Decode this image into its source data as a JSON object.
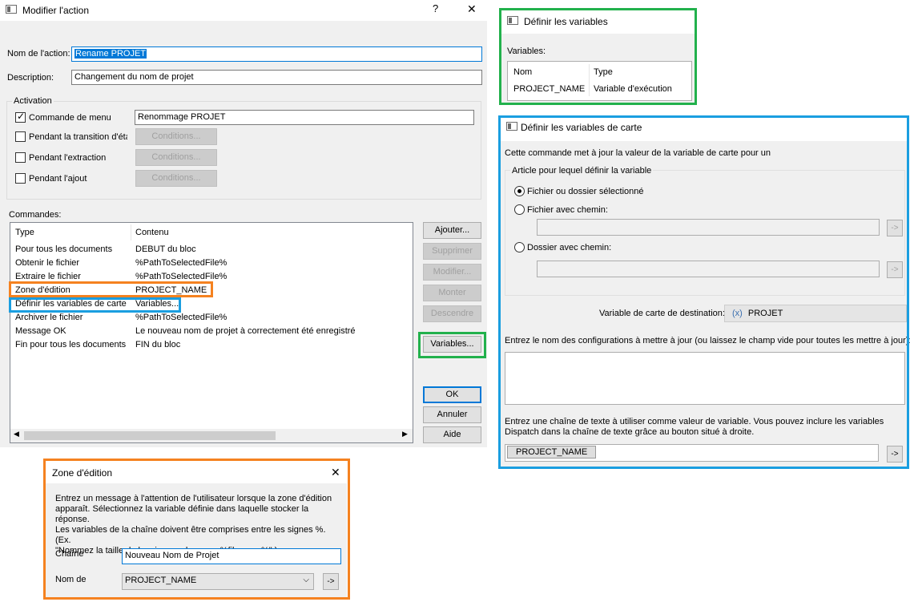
{
  "modifier": {
    "title": "Modifier l'action",
    "help": "?",
    "close": "✕",
    "nom_label": "Nom de l'action:",
    "nom_value": "Rename PROJET",
    "desc_label": "Description:",
    "desc_value": "Changement du nom de projet",
    "activation_label": "Activation",
    "activations": [
      {
        "label": "Commande de menu",
        "value": "Renommage PROJET"
      },
      {
        "label": "Pendant la transition d'état",
        "button": "Conditions..."
      },
      {
        "label": "Pendant l'extraction",
        "button": "Conditions..."
      },
      {
        "label": "Pendant l'ajout",
        "button": "Conditions..."
      }
    ],
    "commandes_label": "Commandes:",
    "columns": [
      "Type",
      "Contenu"
    ],
    "rows": [
      {
        "type": "Pour tous les documents",
        "contenu": "DEBUT du bloc"
      },
      {
        "type": "Obtenir le fichier",
        "contenu": "%PathToSelectedFile%"
      },
      {
        "type": "Extraire le fichier",
        "contenu": "%PathToSelectedFile%"
      },
      {
        "type": "Zone d'édition",
        "contenu": "PROJECT_NAME"
      },
      {
        "type": "Définir les variables de carte",
        "contenu": "Variables..."
      },
      {
        "type": "Archiver le fichier",
        "contenu": "%PathToSelectedFile%"
      },
      {
        "type": "Message OK",
        "contenu": "Le nouveau nom de projet à correctement été enregistré"
      },
      {
        "type": "Fin pour tous les documents",
        "contenu": "FIN du bloc"
      }
    ],
    "buttons": {
      "ajouter": "Ajouter...",
      "supprimer": "Supprimer",
      "modifier": "Modifier...",
      "monter": "Monter",
      "descendre": "Descendre",
      "variables": "Variables...",
      "ok": "OK",
      "annuler": "Annuler",
      "aide": "Aide"
    }
  },
  "variables": {
    "title": "Définir les variables",
    "label": "Variables:",
    "columns": [
      "Nom",
      "Type"
    ],
    "rows": [
      {
        "nom": "PROJECT_NAME",
        "type": "Variable d'exécution"
      }
    ]
  },
  "carte": {
    "title": "Définir les variables de carte",
    "intro": "Cette commande met à jour la valeur de la variable de carte pour un",
    "group_label": "Article pour lequel définir la variable",
    "opt1": "Fichier ou dossier sélectionné",
    "opt2": "Fichier avec chemin:",
    "opt3": "Dossier avec chemin:",
    "arrow": "->",
    "dest_label": "Variable de carte de destination:",
    "dest_icon": "(x)",
    "dest_value": "PROJET",
    "config_label": "Entrez le nom des configurations à mettre à jour (ou laissez le champ vide pour toutes les mettre à jour):",
    "text_label_1": "Entrez une chaîne de texte à utiliser comme valeur de variable. Vous pouvez inclure les variables",
    "text_label_2": "Dispatch dans la chaîne de texte grâce au bouton situé à droite.",
    "token": "PROJECT_NAME"
  },
  "zone": {
    "title": "Zone d'édition",
    "close": "✕",
    "message_1": "Entrez un message à l'attention de l'utilisateur lorsque la zone d'édition",
    "message_2": "apparaît. Sélectionnez la variable définie dans laquelle stocker la réponse.",
    "message_3": "Les variables de la chaîne doivent être comprises entre les signes %.  (Ex.",
    "message_4": "\"Nommez la taille de la mise en plan pour %filename%\" ).",
    "chaine_label": "Chaîne",
    "chaine_value": "Nouveau Nom de Projet",
    "nom_label": "Nom de",
    "nom_value": "PROJECT_NAME",
    "arrow": "->"
  },
  "colors": {
    "orange": "#f58220",
    "blue": "#1a9ee0",
    "green": "#22b14c",
    "focus": "#0078d7"
  }
}
